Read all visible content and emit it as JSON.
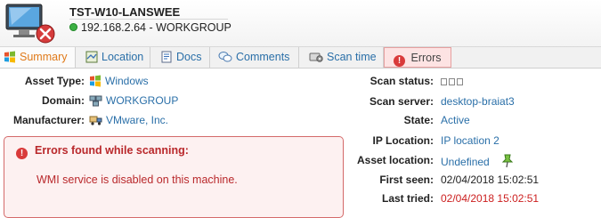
{
  "header": {
    "asset_name": "TST-W10-LANSWEE",
    "ip_workgroup": "192.168.2.64 - WORKGROUP"
  },
  "tabs": [
    {
      "label": "Summary",
      "icon": "windows-logo-icon"
    },
    {
      "label": "Location",
      "icon": "map-icon"
    },
    {
      "label": "Docs",
      "icon": "document-icon"
    },
    {
      "label": "Comments",
      "icon": "chat-bubbles-icon"
    },
    {
      "label": "Scan time",
      "icon": "scanner-gear-icon"
    },
    {
      "label": "Errors",
      "icon": "error-icon"
    }
  ],
  "left_info": {
    "asset_type": {
      "label": "Asset Type:",
      "value": "Windows"
    },
    "domain": {
      "label": "Domain:",
      "value": "WORKGROUP"
    },
    "manufacturer": {
      "label": "Manufacturer:",
      "value": "VMware, Inc."
    }
  },
  "errors": {
    "title": "Errors found while scanning:",
    "message": "WMI service is disabled on this machine."
  },
  "right_info": {
    "scan_status": {
      "label": "Scan status:"
    },
    "scan_server": {
      "label": "Scan server:",
      "value": "desktop-braiat3"
    },
    "state": {
      "label": "State:",
      "value": "Active"
    },
    "ip_location": {
      "label": "IP Location:",
      "value": "IP location 2"
    },
    "asset_location": {
      "label": "Asset location:",
      "value": "Undefined"
    },
    "first_seen": {
      "label": "First seen:",
      "value": "02/04/2018 15:02:51"
    },
    "last_tried": {
      "label": "Last tried:",
      "value": "02/04/2018 15:02:51"
    }
  },
  "colors": {
    "link": "#2a6fa8",
    "error_red": "#b9282b",
    "online_green": "#3cb043",
    "active_tab_orange": "#e07a1a"
  }
}
